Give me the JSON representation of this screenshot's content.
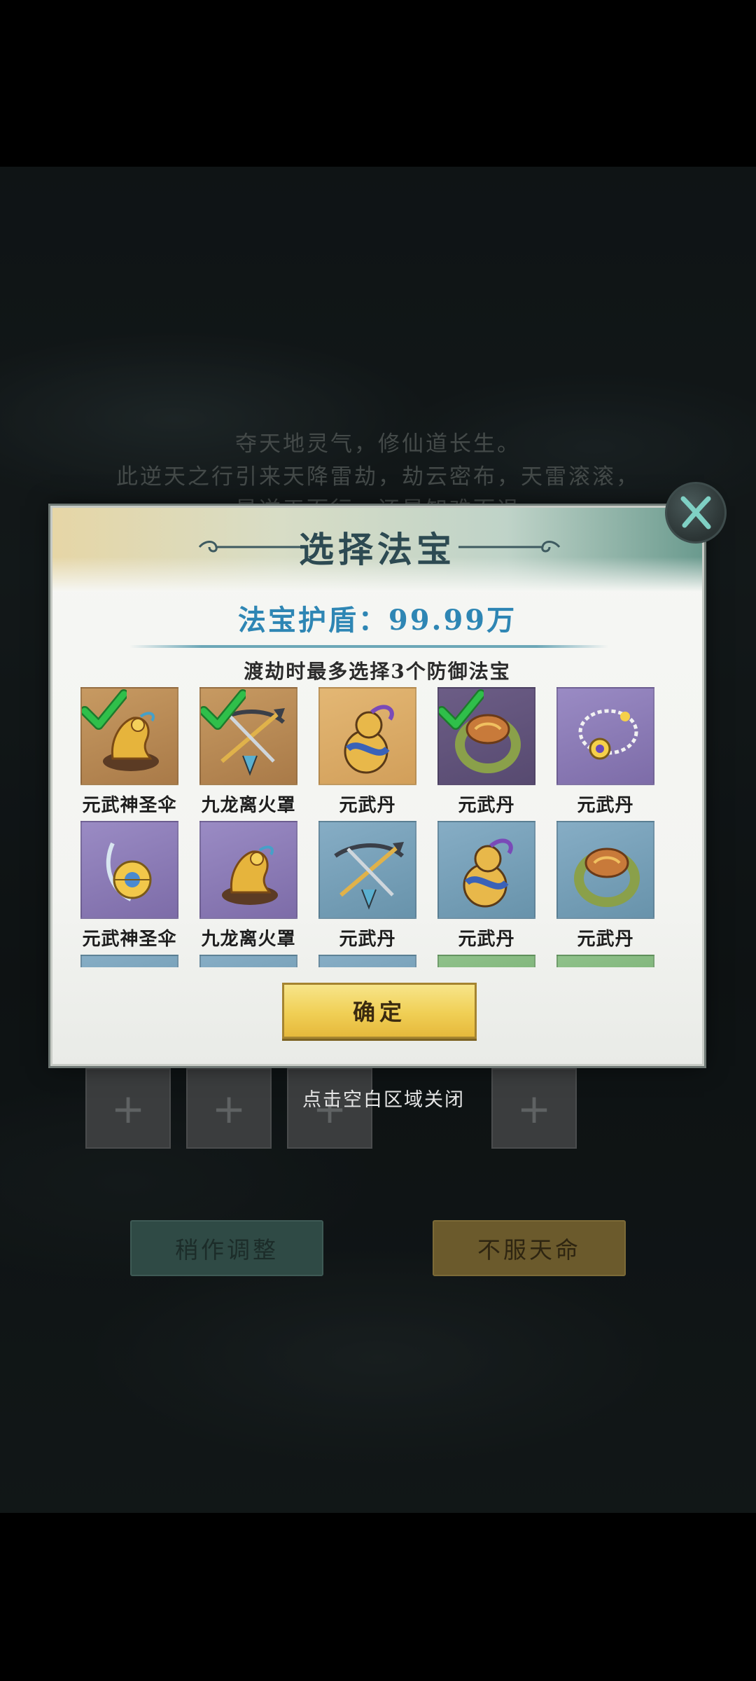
{
  "background": {
    "story_lines": [
      "夺天地灵气，修仙道长生。",
      "此逆天之行引来天降雷劫，劫云密布，天雷滚滚，",
      "是逆天而行，还是知难而退"
    ],
    "close_hint": "点击空白区域关闭",
    "slot_symbol": "+",
    "buttons": {
      "adjust": "稍作调整",
      "defy": "不服天命"
    }
  },
  "dialog": {
    "title": "选择法宝",
    "shield_text": "法宝护盾：99.99万",
    "subtitle": "渡劫时最多选择3个防御法宝",
    "confirm": "确定",
    "items": [
      {
        "name": "元武神圣伞",
        "quality": "gold",
        "icon": "dragon-statue-icon",
        "selected": true
      },
      {
        "name": "九龙离火罩",
        "quality": "gold",
        "icon": "crossbow-icon",
        "selected": true
      },
      {
        "name": "元武丹",
        "quality": "orange",
        "icon": "gourd-icon",
        "selected": false
      },
      {
        "name": "元武丹",
        "quality": "darkpurple",
        "icon": "ring-icon",
        "selected": true
      },
      {
        "name": "元武丹",
        "quality": "purple",
        "icon": "necklace-icon",
        "selected": false
      },
      {
        "name": "元武神圣伞",
        "quality": "purple",
        "icon": "amulet-icon",
        "selected": false
      },
      {
        "name": "九龙离火罩",
        "quality": "purple",
        "icon": "dragon-statue-icon",
        "selected": false
      },
      {
        "name": "元武丹",
        "quality": "blue",
        "icon": "crossbow-icon",
        "selected": false
      },
      {
        "name": "元武丹",
        "quality": "blue",
        "icon": "gourd-icon",
        "selected": false
      },
      {
        "name": "元武丹",
        "quality": "blue",
        "icon": "ring-icon",
        "selected": false
      },
      {
        "name": "",
        "quality": "blue",
        "icon": "",
        "selected": false
      },
      {
        "name": "",
        "quality": "blue",
        "icon": "",
        "selected": false
      },
      {
        "name": "",
        "quality": "blue",
        "icon": "",
        "selected": false
      },
      {
        "name": "",
        "quality": "green",
        "icon": "",
        "selected": false
      },
      {
        "name": "",
        "quality": "green",
        "icon": "",
        "selected": false
      }
    ]
  },
  "colors": {
    "title": "#2d4a52",
    "shield": "#2e86b4",
    "confirm_button": "#f0cf55",
    "check_mark": "#2fbf4a"
  }
}
